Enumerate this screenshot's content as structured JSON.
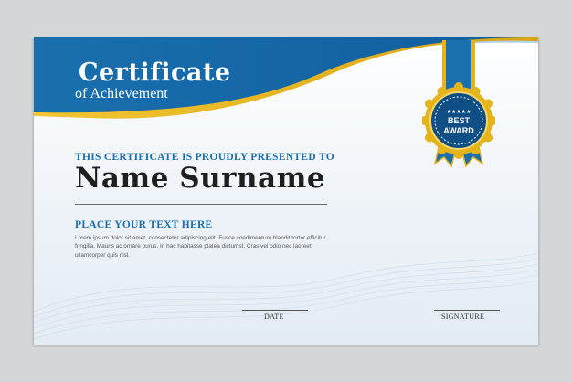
{
  "certificate": {
    "title": "Certificate",
    "subtitle": "of Achievement",
    "presented_to": "THIS CERTIFICATE IS PROUDLY PRESENTED TO",
    "recipient_name": "Name Surname",
    "section_heading": "PLACE YOUR TEXT HERE",
    "body_text": "Lorem ipsum dolor sit amet, consectetur adipiscing elit. Fusce condimentum blandit tortor efficitur fringilla. Mauris ac ornare purus. In hac habitasse platea dictumst. Cras vel odio nec laoreet ullamcorper quis nisl.",
    "date_label": "DATE",
    "signature_label": "SIGNATURE"
  },
  "badge": {
    "line1": "BEST",
    "line2": "AWARD",
    "stars": "★★★★★"
  },
  "colors": {
    "primary_blue": "#1a6fae",
    "dark_blue": "#0f4f86",
    "gold": "#e4b41a",
    "background": "#d4d6d8"
  }
}
